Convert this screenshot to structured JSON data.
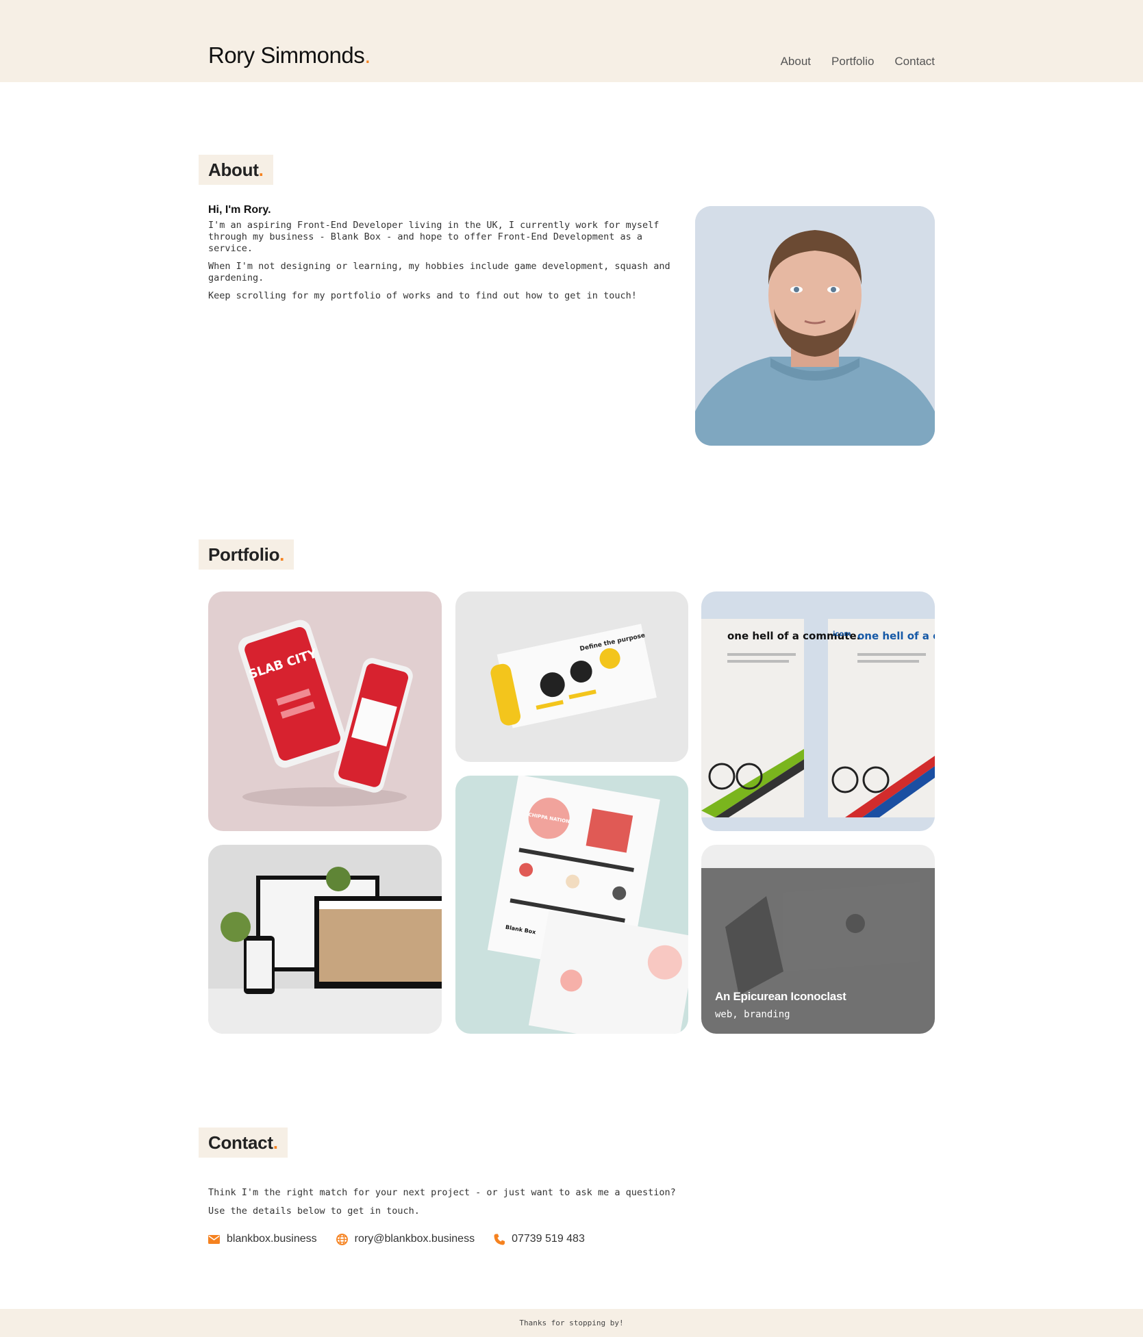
{
  "header": {
    "logo": "Rory Simmonds",
    "logo_dot": ".",
    "nav": [
      "About",
      "Portfolio",
      "Contact"
    ]
  },
  "about": {
    "title": "About",
    "greeting": "Hi, I'm Rory.",
    "paragraphs": [
      "I'm an aspiring Front-End Developer living in the UK, I currently work for myself through my business - Blank Box - and hope to offer Front-End Development as a service.",
      "When I'm not designing or learning, my hobbies include game development, squash and gardening.",
      "Keep scrolling for my portfolio of works and to find out how to get in touch!"
    ]
  },
  "portfolio": {
    "title": "Portfolio",
    "mockup_text": {
      "slab_city": "SLAB CITY",
      "define_purpose": "Define the purpose",
      "commute_heading": "one hell of a commute.",
      "icom": "icom",
      "chippa_nation": "CHIPPA NATION",
      "blank_box": "Blank Box"
    },
    "hovered_item": {
      "title": "An Epicurean Iconoclast",
      "tags": "web, branding"
    }
  },
  "contact": {
    "title": "Contact",
    "lines": [
      "Think I'm the right match for your next project - or just want to ask me a question?",
      "Use the details below to get in touch."
    ],
    "items": [
      {
        "icon": "envelope-icon",
        "text": "blankbox.business"
      },
      {
        "icon": "globe-icon",
        "text": "rory@blankbox.business"
      },
      {
        "icon": "phone-icon",
        "text": "07739 519 483"
      }
    ]
  },
  "footer": {
    "text": "Thanks for stopping by!"
  },
  "colors": {
    "accent": "#f58220",
    "header_bg": "#f6efe5"
  }
}
